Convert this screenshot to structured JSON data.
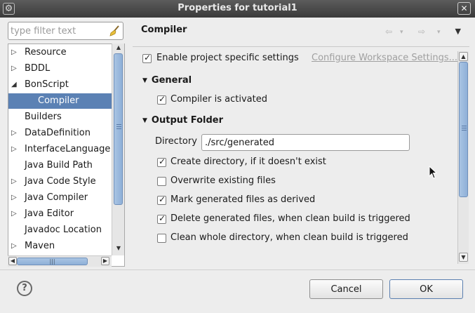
{
  "window": {
    "title": "Properties for tutorial1",
    "close_glyph": "✕",
    "app_icon_glyph": "⚙"
  },
  "filter": {
    "placeholder": "type filter text"
  },
  "nav": {
    "items": [
      {
        "label": "Resource",
        "expandable": true
      },
      {
        "label": "BDDL",
        "expandable": true
      },
      {
        "label": "BonScript",
        "expandable": true,
        "expanded": true
      },
      {
        "label": "Compiler",
        "expandable": false,
        "selected": true,
        "child": true
      },
      {
        "label": "Builders",
        "expandable": false
      },
      {
        "label": "DataDefinition",
        "expandable": true
      },
      {
        "label": "InterfaceLanguage",
        "expandable": true
      },
      {
        "label": "Java Build Path",
        "expandable": false
      },
      {
        "label": "Java Code Style",
        "expandable": true
      },
      {
        "label": "Java Compiler",
        "expandable": true
      },
      {
        "label": "Java Editor",
        "expandable": true
      },
      {
        "label": "Javadoc Location",
        "expandable": false
      },
      {
        "label": "Maven",
        "expandable": true
      }
    ]
  },
  "page": {
    "title": "Compiler",
    "back_glyph": "⇦",
    "forward_glyph": "⇨",
    "dropdown_glyph": "▾",
    "menu_glyph": "▼"
  },
  "settings": {
    "enable_project_specific": {
      "label": "Enable project specific settings",
      "checked": true
    },
    "configure_link": "Configure Workspace Settings...",
    "general_section": "General",
    "compiler_activated": {
      "label": "Compiler is activated",
      "checked": true
    },
    "output_section": "Output Folder",
    "directory_label": "Directory",
    "directory_value": "./src/generated",
    "options": [
      {
        "label": "Create directory, if it doesn't exist",
        "checked": true
      },
      {
        "label": "Overwrite existing files",
        "checked": false
      },
      {
        "label": "Mark generated files as derived",
        "checked": true
      },
      {
        "label": "Delete generated files, when clean build is triggered",
        "checked": true
      },
      {
        "label": "Clean whole directory, when clean build is triggered",
        "checked": false
      }
    ]
  },
  "footer": {
    "help_glyph": "?",
    "cancel_label": "Cancel",
    "ok_label": "OK"
  },
  "colors": {
    "selection": "#5b81b4",
    "titlebar": "#3a3a3a",
    "scroll_thumb": "#8fb0d8"
  }
}
